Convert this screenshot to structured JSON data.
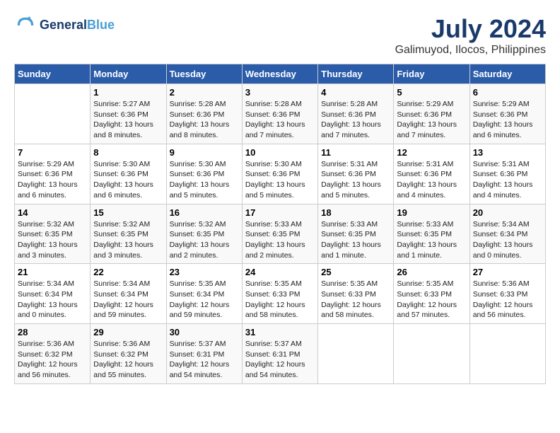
{
  "header": {
    "logo_line1": "General",
    "logo_line2": "Blue",
    "month_year": "July 2024",
    "location": "Galimuyod, Ilocos, Philippines"
  },
  "weekdays": [
    "Sunday",
    "Monday",
    "Tuesday",
    "Wednesday",
    "Thursday",
    "Friday",
    "Saturday"
  ],
  "weeks": [
    [
      {
        "day": "",
        "info": ""
      },
      {
        "day": "1",
        "info": "Sunrise: 5:27 AM\nSunset: 6:36 PM\nDaylight: 13 hours\nand 8 minutes."
      },
      {
        "day": "2",
        "info": "Sunrise: 5:28 AM\nSunset: 6:36 PM\nDaylight: 13 hours\nand 8 minutes."
      },
      {
        "day": "3",
        "info": "Sunrise: 5:28 AM\nSunset: 6:36 PM\nDaylight: 13 hours\nand 7 minutes."
      },
      {
        "day": "4",
        "info": "Sunrise: 5:28 AM\nSunset: 6:36 PM\nDaylight: 13 hours\nand 7 minutes."
      },
      {
        "day": "5",
        "info": "Sunrise: 5:29 AM\nSunset: 6:36 PM\nDaylight: 13 hours\nand 7 minutes."
      },
      {
        "day": "6",
        "info": "Sunrise: 5:29 AM\nSunset: 6:36 PM\nDaylight: 13 hours\nand 6 minutes."
      }
    ],
    [
      {
        "day": "7",
        "info": "Sunrise: 5:29 AM\nSunset: 6:36 PM\nDaylight: 13 hours\nand 6 minutes."
      },
      {
        "day": "8",
        "info": "Sunrise: 5:30 AM\nSunset: 6:36 PM\nDaylight: 13 hours\nand 6 minutes."
      },
      {
        "day": "9",
        "info": "Sunrise: 5:30 AM\nSunset: 6:36 PM\nDaylight: 13 hours\nand 5 minutes."
      },
      {
        "day": "10",
        "info": "Sunrise: 5:30 AM\nSunset: 6:36 PM\nDaylight: 13 hours\nand 5 minutes."
      },
      {
        "day": "11",
        "info": "Sunrise: 5:31 AM\nSunset: 6:36 PM\nDaylight: 13 hours\nand 5 minutes."
      },
      {
        "day": "12",
        "info": "Sunrise: 5:31 AM\nSunset: 6:36 PM\nDaylight: 13 hours\nand 4 minutes."
      },
      {
        "day": "13",
        "info": "Sunrise: 5:31 AM\nSunset: 6:36 PM\nDaylight: 13 hours\nand 4 minutes."
      }
    ],
    [
      {
        "day": "14",
        "info": "Sunrise: 5:32 AM\nSunset: 6:35 PM\nDaylight: 13 hours\nand 3 minutes."
      },
      {
        "day": "15",
        "info": "Sunrise: 5:32 AM\nSunset: 6:35 PM\nDaylight: 13 hours\nand 3 minutes."
      },
      {
        "day": "16",
        "info": "Sunrise: 5:32 AM\nSunset: 6:35 PM\nDaylight: 13 hours\nand 2 minutes."
      },
      {
        "day": "17",
        "info": "Sunrise: 5:33 AM\nSunset: 6:35 PM\nDaylight: 13 hours\nand 2 minutes."
      },
      {
        "day": "18",
        "info": "Sunrise: 5:33 AM\nSunset: 6:35 PM\nDaylight: 13 hours\nand 1 minute."
      },
      {
        "day": "19",
        "info": "Sunrise: 5:33 AM\nSunset: 6:35 PM\nDaylight: 13 hours\nand 1 minute."
      },
      {
        "day": "20",
        "info": "Sunrise: 5:34 AM\nSunset: 6:34 PM\nDaylight: 13 hours\nand 0 minutes."
      }
    ],
    [
      {
        "day": "21",
        "info": "Sunrise: 5:34 AM\nSunset: 6:34 PM\nDaylight: 13 hours\nand 0 minutes."
      },
      {
        "day": "22",
        "info": "Sunrise: 5:34 AM\nSunset: 6:34 PM\nDaylight: 12 hours\nand 59 minutes."
      },
      {
        "day": "23",
        "info": "Sunrise: 5:35 AM\nSunset: 6:34 PM\nDaylight: 12 hours\nand 59 minutes."
      },
      {
        "day": "24",
        "info": "Sunrise: 5:35 AM\nSunset: 6:33 PM\nDaylight: 12 hours\nand 58 minutes."
      },
      {
        "day": "25",
        "info": "Sunrise: 5:35 AM\nSunset: 6:33 PM\nDaylight: 12 hours\nand 58 minutes."
      },
      {
        "day": "26",
        "info": "Sunrise: 5:35 AM\nSunset: 6:33 PM\nDaylight: 12 hours\nand 57 minutes."
      },
      {
        "day": "27",
        "info": "Sunrise: 5:36 AM\nSunset: 6:33 PM\nDaylight: 12 hours\nand 56 minutes."
      }
    ],
    [
      {
        "day": "28",
        "info": "Sunrise: 5:36 AM\nSunset: 6:32 PM\nDaylight: 12 hours\nand 56 minutes."
      },
      {
        "day": "29",
        "info": "Sunrise: 5:36 AM\nSunset: 6:32 PM\nDaylight: 12 hours\nand 55 minutes."
      },
      {
        "day": "30",
        "info": "Sunrise: 5:37 AM\nSunset: 6:31 PM\nDaylight: 12 hours\nand 54 minutes."
      },
      {
        "day": "31",
        "info": "Sunrise: 5:37 AM\nSunset: 6:31 PM\nDaylight: 12 hours\nand 54 minutes."
      },
      {
        "day": "",
        "info": ""
      },
      {
        "day": "",
        "info": ""
      },
      {
        "day": "",
        "info": ""
      }
    ]
  ]
}
